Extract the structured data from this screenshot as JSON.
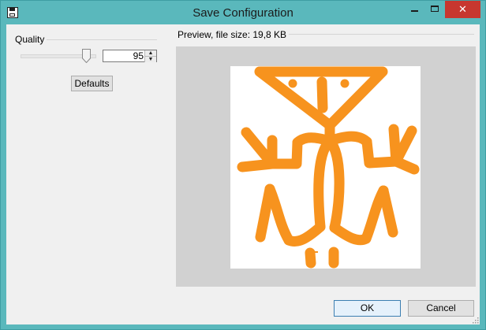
{
  "window": {
    "title": "Save Configuration",
    "app_icon": "floppy-disk-icon",
    "controls": [
      "minimize-icon",
      "maximize-icon",
      "close-icon"
    ]
  },
  "quality": {
    "group_label": "Quality",
    "value": "95",
    "slider_level_percent": 95,
    "defaults_label": "Defaults"
  },
  "preview": {
    "label": "Preview, file size: 19,8 KB",
    "image": "orange-lizard-petroglyph",
    "stroke_color": "#f7931e"
  },
  "buttons": {
    "ok_label": "OK",
    "cancel_label": "Cancel"
  },
  "colors": {
    "titlebar": "#5ab8bc",
    "close": "#c7372f",
    "client": "#f0f0f0",
    "preview_bg": "#d1d1d1"
  }
}
